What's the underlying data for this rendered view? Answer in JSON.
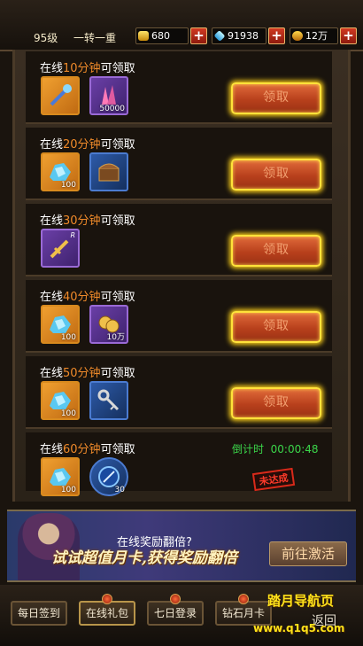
{
  "topbar": {
    "level": "95级",
    "rebirth": "一转一重",
    "gold": {
      "value": "680",
      "icon": "gold-ingot-icon"
    },
    "diamond": {
      "value": "91938",
      "icon": "diamond-icon"
    },
    "coin": {
      "value": "12万",
      "icon": "coin-icon"
    }
  },
  "rewards": [
    {
      "prefix": "在线",
      "minutes": "10分钟",
      "suffix": "可领取",
      "claim_label": "领取",
      "items": [
        {
          "icon": "scepter-icon",
          "count": ""
        },
        {
          "icon": "crystal-icon",
          "count": "50000"
        }
      ]
    },
    {
      "prefix": "在线",
      "minutes": "20分钟",
      "suffix": "可领取",
      "claim_label": "领取",
      "items": [
        {
          "icon": "blue-ore-icon",
          "count": "100"
        },
        {
          "icon": "treasure-chest-icon",
          "count": ""
        }
      ]
    },
    {
      "prefix": "在线",
      "minutes": "30分钟",
      "suffix": "可领取",
      "claim_label": "领取",
      "items": [
        {
          "icon": "golden-sword-icon",
          "count": "",
          "rarity": "R"
        }
      ]
    },
    {
      "prefix": "在线",
      "minutes": "40分钟",
      "suffix": "可领取",
      "claim_label": "领取",
      "items": [
        {
          "icon": "blue-ore-icon",
          "count": "100"
        },
        {
          "icon": "gold-coins-icon",
          "count": "10万"
        }
      ]
    },
    {
      "prefix": "在线",
      "minutes": "50分钟",
      "suffix": "可领取",
      "claim_label": "领取",
      "items": [
        {
          "icon": "blue-ore-icon",
          "count": "100"
        },
        {
          "icon": "key-icon",
          "count": ""
        }
      ]
    },
    {
      "prefix": "在线",
      "minutes": "60分钟",
      "suffix": "可领取",
      "countdown_label": "倒计时",
      "countdown": "00:00:48",
      "status": "未达成",
      "items": [
        {
          "icon": "blue-ore-icon",
          "count": "100"
        },
        {
          "icon": "blue-orb-icon",
          "count": "30"
        }
      ]
    }
  ],
  "banner": {
    "title": "在线奖励翻倍?",
    "slogan": "试试超值月卡,获得奖励翻倍",
    "button": "前往激活"
  },
  "nav": [
    {
      "label": "每日签到",
      "active": false
    },
    {
      "label": "在线礼包",
      "active": true
    },
    {
      "label": "七日登录",
      "active": false
    },
    {
      "label": "钻石月卡",
      "active": false
    }
  ],
  "back_label": "返回",
  "watermark": {
    "line1": "踏月导航页",
    "line2": "www.q1q5.com"
  },
  "colors": {
    "accent_orange": "#ef8a2a",
    "countdown_green": "#3bd64a",
    "claim_glow": "#ffe23a"
  }
}
